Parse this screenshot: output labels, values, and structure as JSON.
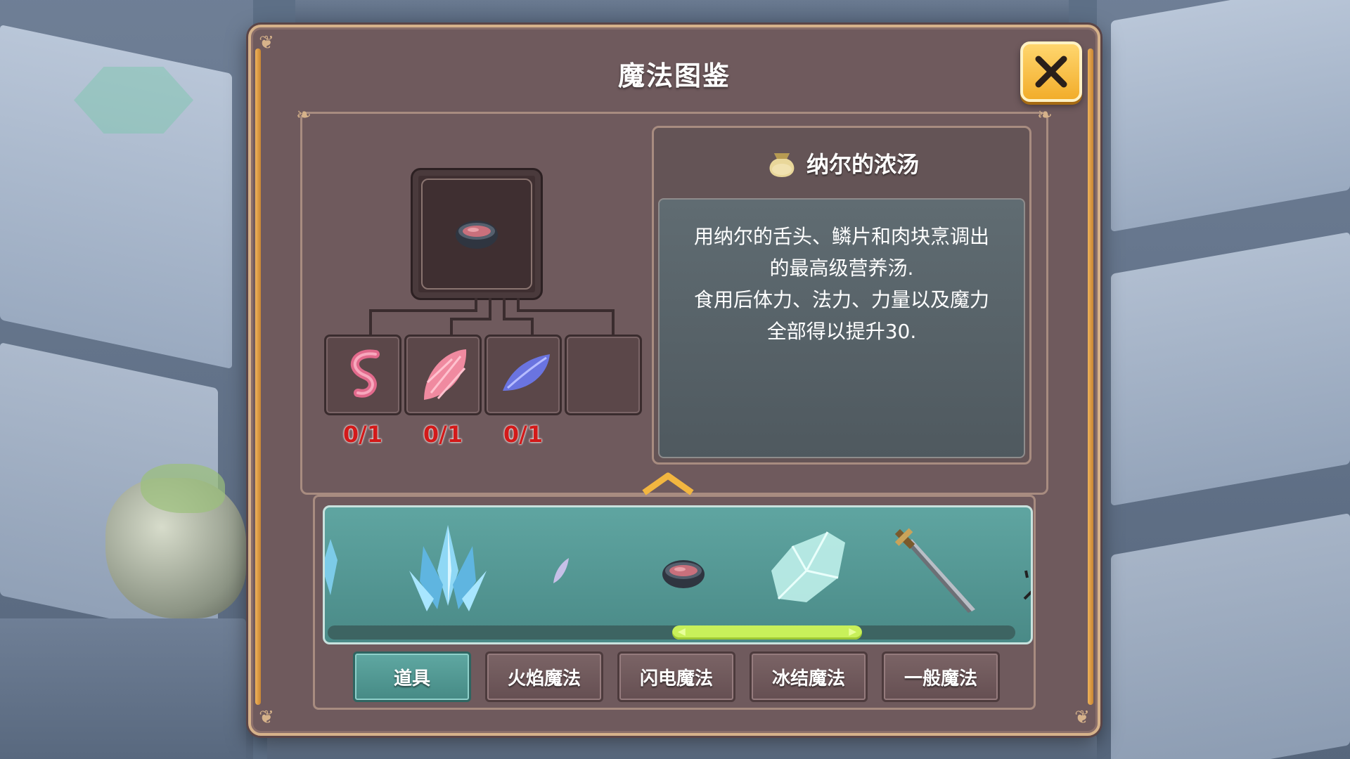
{
  "window": {
    "title": "魔法图鉴",
    "close_icon": "close-x-icon"
  },
  "recipe": {
    "result_icon": "soup-bowl-icon",
    "ingredients": [
      {
        "icon": "tongue-icon",
        "count": "0/1"
      },
      {
        "icon": "pink-scale-icon",
        "count": "0/1"
      },
      {
        "icon": "blue-scale-icon",
        "count": "0/1"
      },
      {
        "icon": "empty-slot",
        "count": ""
      }
    ]
  },
  "detail": {
    "item_icon": "pouch-icon",
    "item_name": "纳尔的浓汤",
    "description_lines": [
      "用纳尔的舌头、鳞片和肉块烹调出",
      "的最高级营养汤.",
      "食用后体力、法力、力量以及魔力",
      "全部得以提升30."
    ]
  },
  "strip": {
    "items": [
      "blue-crystal-cluster-icon",
      "feather-icon",
      "soup-bowl-icon",
      "ice-shard-icon",
      "sword-icon"
    ]
  },
  "tabs": [
    {
      "label": "道具",
      "active": true
    },
    {
      "label": "火焰魔法",
      "active": false
    },
    {
      "label": "闪电魔法",
      "active": false
    },
    {
      "label": "冰结魔法",
      "active": false
    },
    {
      "label": "一般魔法",
      "active": false
    }
  ],
  "colors": {
    "frame": "#6f5a5d",
    "accent_gold": "#f2ad2b",
    "count_red": "#d21a1a",
    "active_tab": "#5fa8a2",
    "scroll_thumb": "#c8f05a"
  }
}
